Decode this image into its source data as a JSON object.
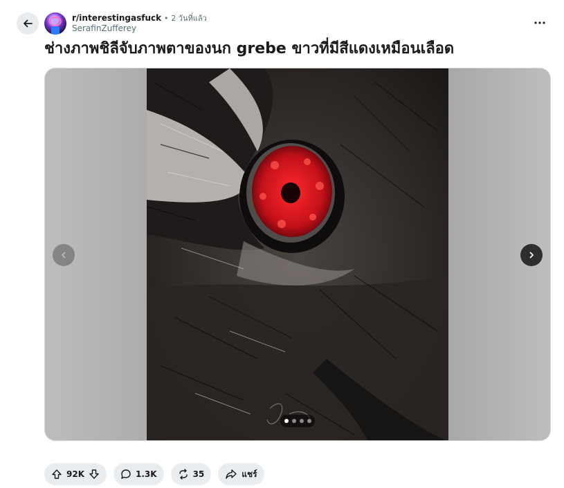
{
  "post": {
    "subreddit": "r/interestingasfuck",
    "separator": "•",
    "time": "2 วันที่แล้ว",
    "author": "SerafinZufferey",
    "title": "ช่างภาพชิลีจับภาพตาของนก grebe ขาวที่มีสีแดงเหมือนเลือด"
  },
  "gallery": {
    "current_index": 1,
    "total": 4,
    "watermark": "J. Zufferey"
  },
  "actions": {
    "votes": "92K",
    "comments": "1.3K",
    "crossposts": "35",
    "share_label": "แชร์"
  },
  "icons": {
    "back": "arrow-left-icon",
    "more": "more-horizontal-icon",
    "upvote": "arrow-up-icon",
    "downvote": "arrow-down-icon",
    "comment": "speech-bubble-icon",
    "crosspost": "repost-icon",
    "share": "share-arrow-icon",
    "prev": "chevron-left-icon",
    "next": "chevron-right-icon"
  },
  "colors": {
    "eye_red": "#d8141f",
    "pill_bg": "#eaedef",
    "text": "#1a1a1b",
    "muted": "#576f76"
  }
}
